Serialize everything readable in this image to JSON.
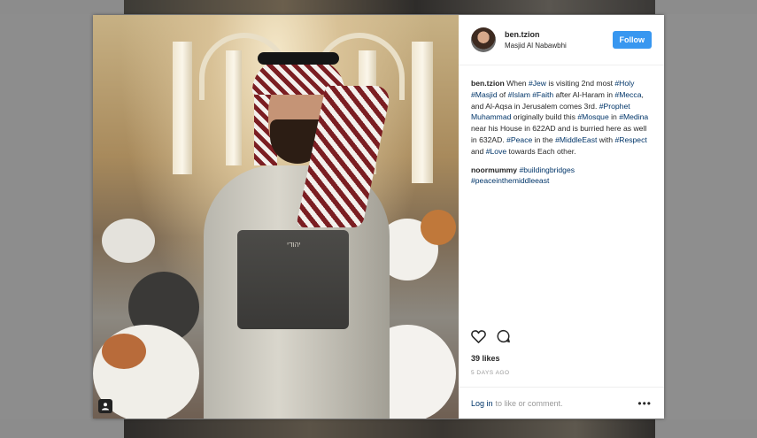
{
  "post": {
    "username": "ben.tzion",
    "location": "Masjid Al Nabawbhi",
    "follow_label": "Follow",
    "caption": {
      "user": "ben.tzion",
      "segments": [
        {
          "text": " When ",
          "tag": false
        },
        {
          "text": "#Jew",
          "tag": true
        },
        {
          "text": " is visiting 2nd most ",
          "tag": false
        },
        {
          "text": "#Holy",
          "tag": true
        },
        {
          "text": " ",
          "tag": false
        },
        {
          "text": "#Masjid",
          "tag": true
        },
        {
          "text": " of ",
          "tag": false
        },
        {
          "text": "#Islam",
          "tag": true
        },
        {
          "text": " ",
          "tag": false
        },
        {
          "text": "#Faith",
          "tag": true
        },
        {
          "text": " after Al-Haram in ",
          "tag": false
        },
        {
          "text": "#Mecca",
          "tag": true
        },
        {
          "text": ", and Al-Aqsa in Jerusalem comes 3rd. ",
          "tag": false
        },
        {
          "text": "#Prophet",
          "tag": true
        },
        {
          "text": " ",
          "tag": false
        },
        {
          "text": "Muhammad",
          "tag": true
        },
        {
          "text": " originally build this ",
          "tag": false
        },
        {
          "text": "#Mosque",
          "tag": true
        },
        {
          "text": " in ",
          "tag": false
        },
        {
          "text": "#Medina",
          "tag": true
        },
        {
          "text": " near his House in 622AD and is burried here as well in 632AD. ",
          "tag": false
        },
        {
          "text": "#Peace",
          "tag": true
        },
        {
          "text": " in the ",
          "tag": false
        },
        {
          "text": "#MiddleEast",
          "tag": true
        },
        {
          "text": " with ",
          "tag": false
        },
        {
          "text": "#Respect",
          "tag": true
        },
        {
          "text": " and ",
          "tag": false
        },
        {
          "text": "#Love",
          "tag": true
        },
        {
          "text": " towards Each other.",
          "tag": false
        }
      ]
    },
    "comment": {
      "user": "noormummy",
      "tags": "#buildingbridges #peaceinthemiddleeast"
    },
    "likes": "39 likes",
    "age": "5 DAYS AGO",
    "footer": {
      "login": "Log in",
      "rest": "to like or comment.",
      "more": "•••"
    },
    "photo": {
      "bag_text": "יהודי"
    }
  },
  "icons": {
    "heart": "heart-icon",
    "comment": "comment-icon",
    "user_tag": "user-tag-icon",
    "more": "more-options-icon"
  },
  "colors": {
    "follow": "#3897f0",
    "hashtag": "#003569",
    "text": "#262626",
    "muted": "#999999"
  }
}
